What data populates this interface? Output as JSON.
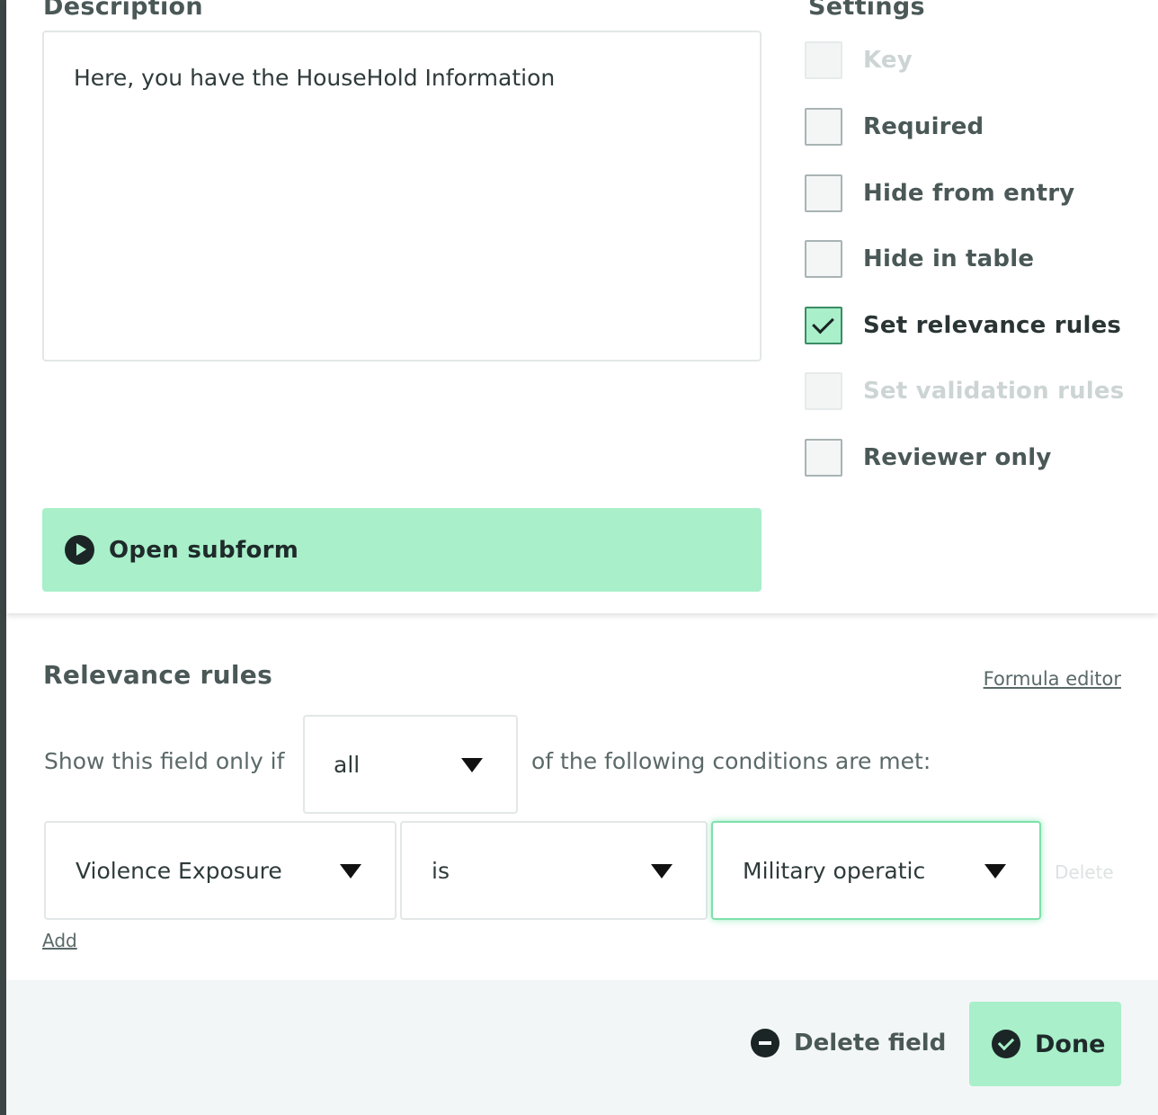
{
  "description": {
    "title": "Description",
    "text": "Here, you have the HouseHold Information"
  },
  "subform": {
    "label": "Open subform",
    "icon": "play-circle-icon"
  },
  "settings": {
    "title": "Settings",
    "items": [
      {
        "label": "Key",
        "checked": false,
        "disabled": true
      },
      {
        "label": "Required",
        "checked": false,
        "disabled": false
      },
      {
        "label": "Hide from entry",
        "checked": false,
        "disabled": false
      },
      {
        "label": "Hide in table",
        "checked": false,
        "disabled": false
      },
      {
        "label": "Set relevance rules",
        "checked": true,
        "disabled": false
      },
      {
        "label": "Set validation rules",
        "checked": false,
        "disabled": true
      },
      {
        "label": "Reviewer only",
        "checked": false,
        "disabled": false
      }
    ]
  },
  "relevance": {
    "title": "Relevance rules",
    "formula_editor": "Formula editor",
    "show_prefix": "Show this field only if",
    "quantifier": "all",
    "show_suffix": "of the following conditions are met:",
    "condition": {
      "field": "Violence Exposure",
      "operator": "is",
      "value": "Military operatic"
    },
    "delete_label": "Delete",
    "add_label": "Add"
  },
  "footer": {
    "delete_field": "Delete field",
    "done": "Done"
  },
  "colors": {
    "accent": "#a8efca",
    "rail": "#3b4546",
    "footer_bg": "#f3f6f6"
  }
}
